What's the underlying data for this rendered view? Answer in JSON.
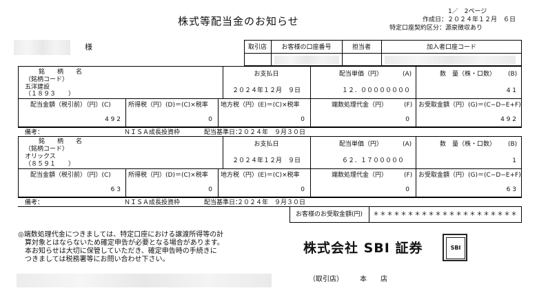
{
  "header": {
    "title": "株式等配当金のお知らせ",
    "page": "1／　2ページ",
    "created": "作成日：２０２４年１２月　６日",
    "tax_category": "特定口座契約区分：源泉徴収あり",
    "honorific": "様"
  },
  "account_header": {
    "branch": "取引店",
    "account_no": "お客様の口座番号",
    "staff": "担当者",
    "subscriber_code": "加入者口座コード"
  },
  "labels": {
    "meigara": "銘　　柄　　名",
    "meigara_code": "（銘柄コード）",
    "payment_date": "お支払日",
    "unit_price": "配当単価（円）",
    "unit_price_mark": "(A)",
    "quantity": "数　量（株・口数）",
    "quantity_mark": "(B)",
    "gross": "配当金額（税引前）（円）(C)",
    "income_tax": "所得税（円）(D)＝(C)×税率",
    "local_tax": "地方税（円）(E)＝(C)×税率",
    "rounding": "端数処理代金（円）",
    "rounding_mark": "(F)",
    "receipt": "お受取金額（円）(G)＝(C−D−E+F)",
    "remarks": "備考：",
    "record_date_label": "配当基準日："
  },
  "records": [
    {
      "name": "五洋建設",
      "code": "（１８９３　　）",
      "payment_date": "２０２４年１２月　９日",
      "unit_price": "１２．００００００００",
      "quantity": "4 1",
      "gross": "4 9 2",
      "income_tax": "0",
      "local_tax": "0",
      "rounding": "0",
      "receipt": "4 9 2",
      "remark": "ＮＩＳＡ成長投資枠",
      "record_date": "２０２４年　９月３０日"
    },
    {
      "name": "オリックス",
      "code": "（８５９１　　）",
      "payment_date": "２０２４年１２月　９日",
      "unit_price": "６２．１７０００００",
      "quantity": "1",
      "gross": "6 3",
      "income_tax": "0",
      "local_tax": "0",
      "rounding": "0",
      "receipt": "6 3",
      "remark": "ＮＩＳＡ成長投資枠",
      "record_date": "２０２４年　９月３０日"
    }
  ],
  "total": {
    "label": "お客様のお受取金額(円)",
    "value": "＊＊＊＊＊＊＊＊＊＊＊＊＊＊＊＊＊＊＊＊＊"
  },
  "notes": [
    "◎端数処理代金につきましては、特定口座における譲渡所得等の計",
    "　算対象とはならないため確定申告が必要となる場合があります。",
    "　本お知らせは大切に保管していただき、確定申告時の手続きに",
    "　つきましては税務署等にお問い合わせ下さい。"
  ],
  "company": {
    "name": "株式会社 SBI 証券",
    "branch_label": "（取引店）",
    "branch_value": "本　　店",
    "seal_text": "SBI"
  }
}
